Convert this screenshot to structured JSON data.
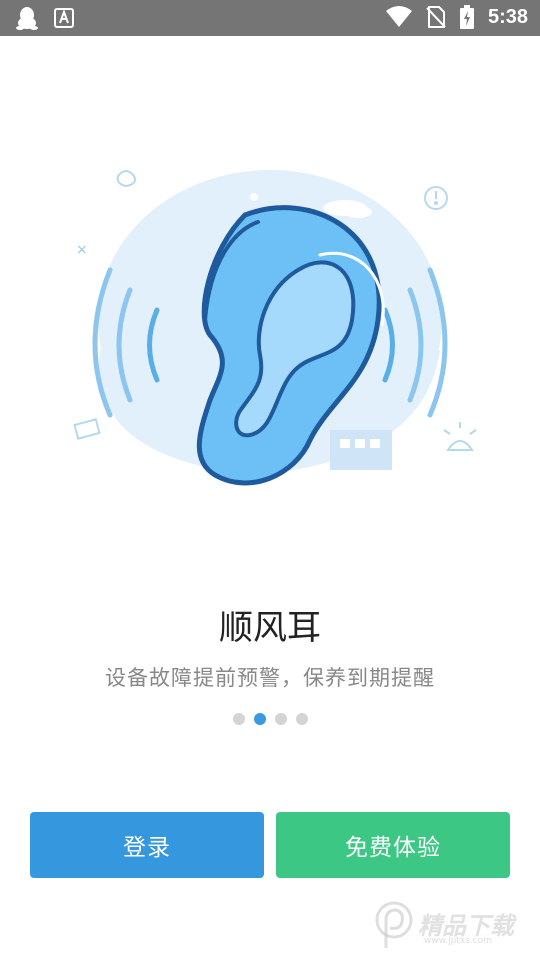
{
  "status_bar": {
    "time": "5:38",
    "notification_icons": [
      "qq-penguin-icon",
      "text-a-icon"
    ],
    "system_icons": [
      "wifi-icon",
      "no-sim-icon",
      "battery-charging-icon"
    ]
  },
  "intro": {
    "title": "顺风耳",
    "subtitle": "设备故障提前预警，保养到期提醒",
    "page_count": 4,
    "active_page": 2
  },
  "actions": {
    "login_label": "登录",
    "trial_label": "免费体验"
  },
  "colors": {
    "primary_blue": "#3597de",
    "green": "#3dc784",
    "dot_active": "#3a9ae0",
    "dot_inactive": "#d4d4d4"
  },
  "watermark": {
    "text": "精品下载",
    "url_text": "www.jptxs.com"
  }
}
